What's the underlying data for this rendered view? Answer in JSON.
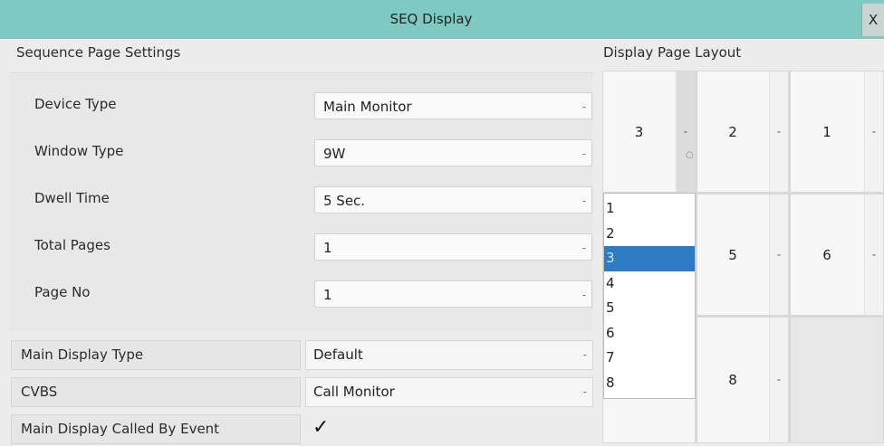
{
  "window": {
    "title": "SEQ Display",
    "close_label": "X"
  },
  "sequence_settings": {
    "title": "Sequence Page Settings",
    "rows": [
      {
        "label": "Device Type",
        "value": "Main Monitor"
      },
      {
        "label": "Window Type",
        "value": "9W"
      },
      {
        "label": "Dwell Time",
        "value": "5 Sec."
      },
      {
        "label": "Total Pages",
        "value": "1"
      },
      {
        "label": "Page No",
        "value": "1"
      }
    ]
  },
  "main_display": {
    "type_label": "Main Display Type",
    "type_value": "Default",
    "cvbs_label": "CVBS",
    "cvbs_value": "Call Monitor",
    "called_by_event_label": "Main Display Called By Event",
    "called_by_event_checked": "✓"
  },
  "caret": "-",
  "display_layout": {
    "title": "Display Page Layout",
    "cells": [
      "3",
      "2",
      "1",
      "",
      "5",
      "6",
      "",
      "8",
      ""
    ],
    "open_dropdown": {
      "options": [
        "1",
        "2",
        "3",
        "4",
        "5",
        "6",
        "7",
        "8"
      ],
      "selected": "3"
    }
  }
}
